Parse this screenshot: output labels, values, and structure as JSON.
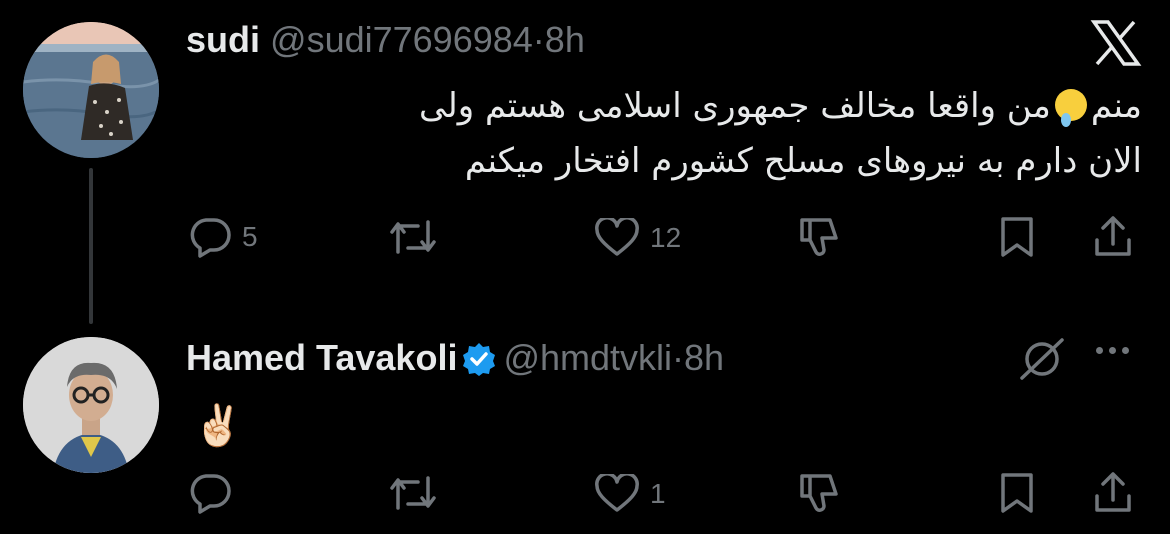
{
  "tweet1": {
    "display_name": "sudi",
    "handle": "@sudi77696984",
    "separator": "·",
    "time": "8h",
    "text_line1_before_emoji": "منم",
    "text_line1_after_emoji": "من واقعا مخالف جمهوری اسلامی هستم ولی",
    "text_line2": "الان دارم به نیروهای مسلح کشورم افتخار میکنم",
    "emoji": "face-holding-back-tears",
    "actions": {
      "reply_count": "5",
      "retweet_count": "",
      "like_count": "12"
    }
  },
  "tweet2": {
    "display_name": "Hamed Tavakoli",
    "handle": "@hmdtvkli",
    "separator": "·",
    "time": "8h",
    "verified": true,
    "text": "✌🏻",
    "actions": {
      "reply_count": "",
      "retweet_count": "",
      "like_count": "1"
    }
  },
  "colors": {
    "background": "#000000",
    "text": "#e7e9ea",
    "muted": "#71767b",
    "verified_blue": "#1d9bf0"
  },
  "icons": [
    "x-logo-icon",
    "reply-icon",
    "retweet-icon",
    "like-icon",
    "dislike-icon",
    "bookmark-icon",
    "share-icon",
    "verified-badge-icon",
    "circle-slash-icon",
    "more-icon"
  ]
}
